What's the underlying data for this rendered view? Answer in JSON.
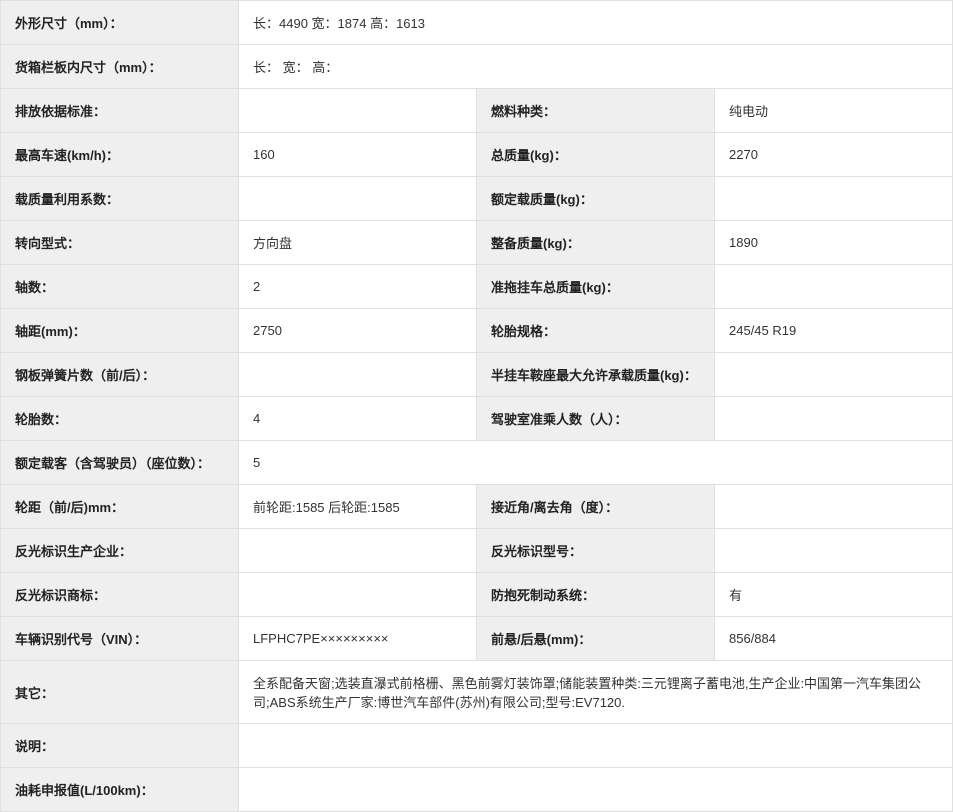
{
  "rows": {
    "dimensions_label": "外形尺寸（mm）：",
    "dimensions_value": "长：4490 宽：1874 高：1613",
    "cargo_inner_label": "货箱栏板内尺寸（mm）：",
    "cargo_inner_value": "长： 宽： 高：",
    "emission_label": "排放依据标准：",
    "emission_value": "",
    "fuel_type_label": "燃料种类：",
    "fuel_type_value": "纯电动",
    "max_speed_label": "最高车速(km/h)：",
    "max_speed_value": "160",
    "total_mass_label": "总质量(kg)：",
    "total_mass_value": "2270",
    "load_util_label": "载质量利用系数：",
    "load_util_value": "",
    "rated_load_label": "额定载质量(kg)：",
    "rated_load_value": "",
    "steering_label": "转向型式：",
    "steering_value": "方向盘",
    "curb_mass_label": "整备质量(kg)：",
    "curb_mass_value": "1890",
    "axles_label": "轴数：",
    "axles_value": "2",
    "trailer_mass_label": "准拖挂车总质量(kg)：",
    "trailer_mass_value": "",
    "wheelbase_label": "轴距(mm)：",
    "wheelbase_value": "2750",
    "tire_spec_label": "轮胎规格：",
    "tire_spec_value": "245/45 R19",
    "leaf_spring_label": "钢板弹簧片数（前/后）：",
    "leaf_spring_value": "",
    "saddle_load_label": "半挂车鞍座最大允许承载质量(kg)：",
    "saddle_load_value": "",
    "tire_count_label": "轮胎数：",
    "tire_count_value": "4",
    "cab_capacity_label": "驾驶室准乘人数（人）：",
    "cab_capacity_value": "",
    "rated_passengers_label": "额定载客（含驾驶员）（座位数）：",
    "rated_passengers_value": "5",
    "track_label": "轮距（前/后)mm：",
    "track_value": "前轮距:1585 后轮距:1585",
    "approach_label": "接近角/离去角（度）：",
    "approach_value": "",
    "reflector_mfr_label": "反光标识生产企业：",
    "reflector_mfr_value": "",
    "reflector_model_label": "反光标识型号：",
    "reflector_model_value": "",
    "reflector_brand_label": "反光标识商标：",
    "reflector_brand_value": "",
    "abs_label": "防抱死制动系统：",
    "abs_value": "有",
    "vin_label": "车辆识别代号（VIN）：",
    "vin_value": "LFPHC7PE×××××××××",
    "overhang_label": "前悬/后悬(mm)：",
    "overhang_value": "856/884",
    "other_label": "其它：",
    "other_value": "全系配备天窗;选装直瀑式前格栅、黑色前雾灯装饰罩;储能装置种类:三元锂离子蓄电池,生产企业:中国第一汽车集团公司;ABS系统生产厂家:博世汽车部件(苏州)有限公司;型号:EV7120.",
    "description_label": "说明：",
    "description_value": "",
    "fuel_consumption_label": "油耗申报值(L/100km)：",
    "fuel_consumption_value": ""
  }
}
